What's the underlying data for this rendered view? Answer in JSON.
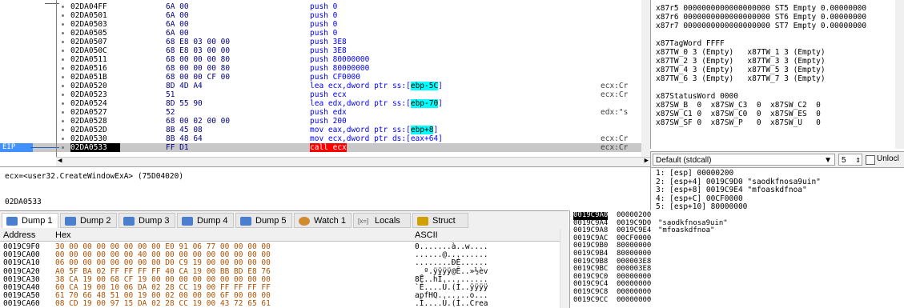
{
  "disasm": {
    "rows": [
      {
        "addr": "02DA04FF",
        "bytes": "6A 00",
        "instr": "push 0",
        "cmt": ""
      },
      {
        "addr": "02DA0501",
        "bytes": "6A 00",
        "instr": "push 0",
        "cmt": ""
      },
      {
        "addr": "02DA0503",
        "bytes": "6A 00",
        "instr": "push 0",
        "cmt": ""
      },
      {
        "addr": "02DA0505",
        "bytes": "6A 00",
        "instr": "push 0",
        "cmt": ""
      },
      {
        "addr": "02DA0507",
        "bytes": "68 E8 03 00 00",
        "instr": "push 3E8",
        "cmt": ""
      },
      {
        "addr": "02DA050C",
        "bytes": "68 E8 03 00 00",
        "instr": "push 3E8",
        "cmt": ""
      },
      {
        "addr": "02DA0511",
        "bytes": "68 00 00 00 80",
        "instr": "push 80000000",
        "cmt": ""
      },
      {
        "addr": "02DA0516",
        "bytes": "68 00 00 00 80",
        "instr": "push 80000000",
        "cmt": ""
      },
      {
        "addr": "02DA051B",
        "bytes": "68 00 00 CF 00",
        "instr": "push CF0000",
        "cmt": ""
      },
      {
        "addr": "02DA0520",
        "bytes": "8D 4D A4",
        "instr_pre": "lea ecx,dword ptr ss:[",
        "instr_hl": "ebp-5C",
        "instr_post": "]",
        "cmt": "ecx:Cr"
      },
      {
        "addr": "02DA0523",
        "bytes": "51",
        "instr": "push ecx",
        "cmt": "ecx:Cr"
      },
      {
        "addr": "02DA0524",
        "bytes": "8D 55 90",
        "instr_pre": "lea edx,dword ptr ss:[",
        "instr_hl": "ebp-70",
        "instr_post": "]",
        "cmt": ""
      },
      {
        "addr": "02DA0527",
        "bytes": "52",
        "instr": "push edx",
        "cmt": "edx:\"s"
      },
      {
        "addr": "02DA0528",
        "bytes": "68 00 02 00 00",
        "instr": "push 200",
        "cmt": ""
      },
      {
        "addr": "02DA052D",
        "bytes": "8B 45 08",
        "instr_pre": "mov eax,dword ptr ss:[",
        "instr_hl": "ebp+8",
        "instr_post": "]",
        "cmt": ""
      },
      {
        "addr": "02DA0530",
        "bytes": "8B 48 64",
        "instr": "mov ecx,dword ptr ds:[eax+64]",
        "cmt": "ecx:Cr"
      },
      {
        "addr": "02DA0533",
        "bytes": "FF D1",
        "instr": "call ecx",
        "cmt": "ecx:Cr"
      }
    ],
    "eip_label": "EIP"
  },
  "info": {
    "line1": "ecx=<user32.CreateWindowExA> (75D04020)",
    "line2": "02DA0533"
  },
  "regs": {
    "lines": [
      "x87r5 0000000000000000000 ST5 Empty 0.00000000",
      "x87r6 0000000000000000000 ST6 Empty 0.00000000",
      "x87r7 0000000000000000000 ST7 Empty 0.00000000",
      "",
      "x87TagWord FFFF",
      "x87TW_0 3 (Empty)   x87TW_1 3 (Empty)",
      "x87TW_2 3 (Empty)   x87TW_3 3 (Empty)",
      "x87TW_4 3 (Empty)   x87TW_5 3 (Empty)",
      "x87TW_6 3 (Empty)   x87TW_7 3 (Empty)",
      "",
      "x87StatusWord 0000",
      "x87SW_B  0  x87SW_C3  0  x87SW_C2  0",
      "x87SW_C1 0  x87SW_C0  0  x87SW_ES  0",
      "x87SW_SF 0  x87SW_P   0  x87SW_U   0"
    ]
  },
  "callconv": {
    "selected": "Default (stdcall)",
    "count": "5",
    "unlock_label": "Unlocl"
  },
  "stackargs": [
    "1: [esp] 00000200",
    "2: [esp+4] 0019C9D0 \"saodkfnosa9uin\"",
    "3: [esp+8] 0019C9E4 \"mfoaskdfnoa\"",
    "4: [esp+C] 00CF0000",
    "5: [esp+10] 80000000"
  ],
  "tabs": [
    {
      "label": "Dump 1",
      "icon": "memory-icon"
    },
    {
      "label": "Dump 2",
      "icon": "memory-icon"
    },
    {
      "label": "Dump 3",
      "icon": "memory-icon"
    },
    {
      "label": "Dump 4",
      "icon": "memory-icon"
    },
    {
      "label": "Dump 5",
      "icon": "memory-icon"
    },
    {
      "label": "Watch 1",
      "icon": "watch-icon"
    },
    {
      "label": "Locals",
      "icon": "locals-icon",
      "prefix": "[x=]"
    },
    {
      "label": "Struct",
      "icon": "struct-icon"
    }
  ],
  "dump": {
    "header_address": "Address",
    "header_hex": "Hex",
    "header_ascii": "ASCII",
    "rows": [
      {
        "a": "0019C9F0",
        "h": "30 00 00 00 00 00 00 00 E0 91 06 77 00 00 00 00",
        "s": "0.......à..w...."
      },
      {
        "a": "0019CA00",
        "h": "00 00 00 00 00 00 40 00 00 00 00 00 00 00 00 00",
        "s": "......@........."
      },
      {
        "a": "0019CA10",
        "h": "06 00 00 00 00 00 00 00 D0 C9 19 00 00 00 00 00",
        "s": "........ÐÉ......"
      },
      {
        "a": "0019CA20",
        "h": "A0 5F BA 02 FF FF FF FF 40 CA 19 00 BB BD E8 76",
        "s": " _º.ÿÿÿÿ@Ê..»½èv"
      },
      {
        "a": "0019CA30",
        "h": "38 CA 19 00 68 CF 19 00 00 00 00 00 00 00 00 00",
        "s": "8Ê..hÏ.........."
      },
      {
        "a": "0019CA40",
        "h": "60 CA 19 00 10 06 DA 02 28 CC 19 00 FF FF FF FF",
        "s": "`Ê....Ú.(Ì..ÿÿÿÿ"
      },
      {
        "a": "0019CA50",
        "h": "61 70 66 48 51 00 19 00 02 00 00 00 6F 00 00 00",
        "s": "apfHQ.......o..."
      },
      {
        "a": "0019CA60",
        "h": "08 CD 19 00 97 15 DA 02 28 CC 19 00 43 72 65 61",
        "s": ".Í....Ú.(Ì..Crea"
      }
    ]
  },
  "stack": {
    "rows": [
      {
        "a": "0019C9A0",
        "v": "00000200",
        "c": ""
      },
      {
        "a": "0019C9A4",
        "v": "0019C9D0",
        "c": "\"saodkfnosa9uin\""
      },
      {
        "a": "0019C9A8",
        "v": "0019C9E4",
        "c": "\"mfoaskdfnoa\""
      },
      {
        "a": "0019C9AC",
        "v": "00CF0000",
        "c": ""
      },
      {
        "a": "0019C9B0",
        "v": "80000000",
        "c": ""
      },
      {
        "a": "0019C9B4",
        "v": "80000000",
        "c": ""
      },
      {
        "a": "0019C9B8",
        "v": "000003E8",
        "c": ""
      },
      {
        "a": "0019C9BC",
        "v": "000003E8",
        "c": ""
      },
      {
        "a": "0019C9C0",
        "v": "00000000",
        "c": ""
      },
      {
        "a": "0019C9C4",
        "v": "00000000",
        "c": ""
      },
      {
        "a": "0019C9C8",
        "v": "00000000",
        "c": ""
      },
      {
        "a": "0019C9CC",
        "v": "00000000",
        "c": ""
      }
    ]
  }
}
